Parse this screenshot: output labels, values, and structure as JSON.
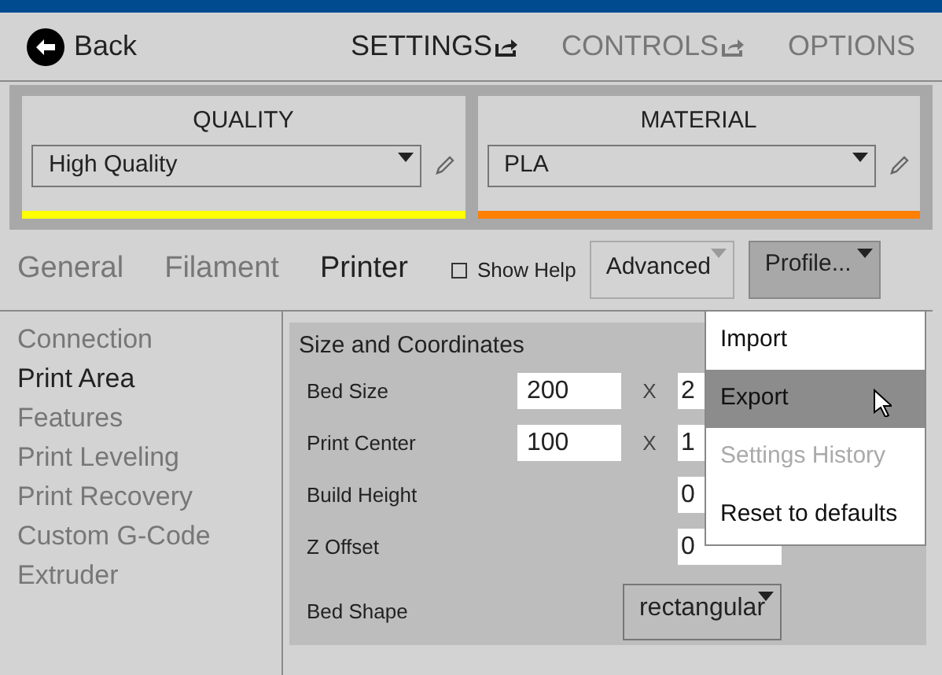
{
  "nav": {
    "back": "Back",
    "tabs": [
      {
        "label": "SETTINGS",
        "selected": true,
        "popout": true
      },
      {
        "label": "CONTROLS",
        "selected": false,
        "popout": true
      },
      {
        "label": "OPTIONS",
        "selected": false,
        "popout": false
      }
    ]
  },
  "presets": [
    {
      "title": "QUALITY",
      "value": "High Quality",
      "color": "#ffff00"
    },
    {
      "title": "MATERIAL",
      "value": "PLA",
      "color": "#ff7f00"
    }
  ],
  "section_tabs": [
    {
      "label": "General",
      "selected": false
    },
    {
      "label": "Filament",
      "selected": false
    },
    {
      "label": "Printer",
      "selected": true
    }
  ],
  "show_help": {
    "label": "Show Help",
    "checked": false
  },
  "level_select": {
    "value": "Advanced"
  },
  "profile_button": {
    "label": "Profile..."
  },
  "sidebar": [
    {
      "label": "Connection",
      "selected": false
    },
    {
      "label": "Print Area",
      "selected": true
    },
    {
      "label": "Features",
      "selected": false
    },
    {
      "label": "Print Leveling",
      "selected": false
    },
    {
      "label": "Print Recovery",
      "selected": false
    },
    {
      "label": "Custom G-Code",
      "selected": false
    },
    {
      "label": "Extruder",
      "selected": false
    }
  ],
  "group": {
    "title": "Size and Coordinates",
    "rows": [
      {
        "kind": "pair",
        "label": "Bed Size",
        "value": "200",
        "separator": "X",
        "value2": "2"
      },
      {
        "kind": "pair",
        "label": "Print Center",
        "value": "100",
        "separator": "X",
        "value2": "1"
      },
      {
        "kind": "single",
        "label": "Build Height",
        "value": "0"
      },
      {
        "kind": "single",
        "label": "Z Offset",
        "value": "0"
      },
      {
        "kind": "select",
        "label": "Bed Shape",
        "value": "rectangular"
      }
    ]
  },
  "menu": [
    {
      "label": "Import",
      "selected": false,
      "disabled": false
    },
    {
      "label": "Export",
      "selected": true,
      "disabled": false
    },
    {
      "label": "Settings History",
      "selected": false,
      "disabled": true
    },
    {
      "label": "Reset to defaults",
      "selected": false,
      "disabled": false
    }
  ]
}
